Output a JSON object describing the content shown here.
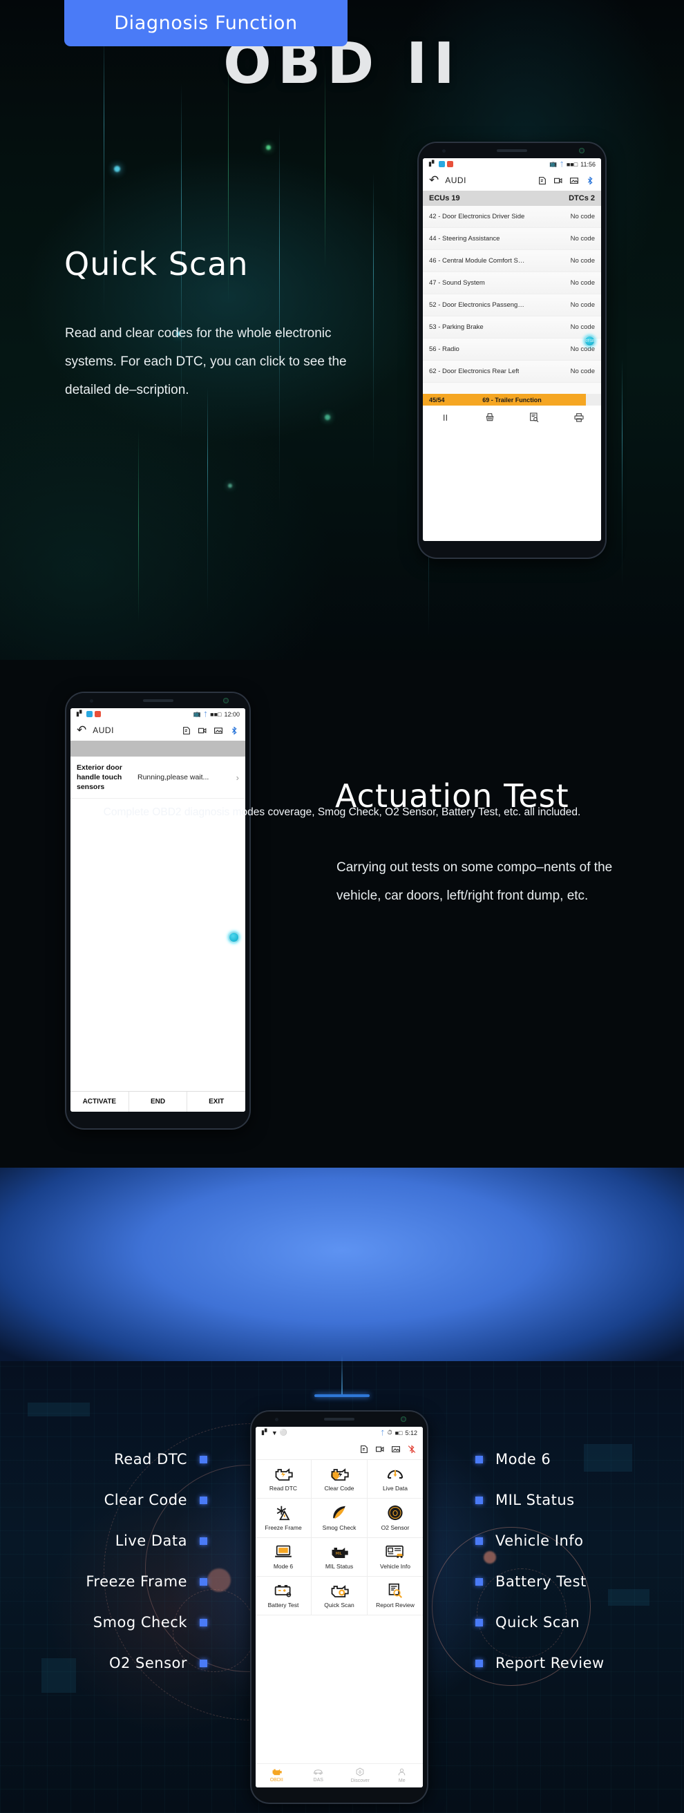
{
  "banner": {
    "title": "Diagnosis Function"
  },
  "section_quick_scan": {
    "title": "Quick Scan",
    "paragraph": "Read and clear codes for the whole electronic systems. For each DTC, you can click to see the detailed de–scription."
  },
  "section_actuation": {
    "title": "Actuation Test",
    "paragraph": "Carrying out tests on some compo–nents of the vehicle, car doors, left/right front dump, etc."
  },
  "phone_quick_scan": {
    "status": {
      "time": "11:56",
      "bluetooth_icon": "bluetooth-icon",
      "battery_icon": "battery-icon",
      "signal_icon": "signal-icon",
      "cast_icon": "cast-icon"
    },
    "appbar": {
      "back_icon": "back-arrow-icon",
      "title": "AUDI",
      "icons": [
        "note-edit-icon",
        "video-record-icon",
        "screenshot-icon",
        "bluetooth-connected-icon"
      ]
    },
    "table_header": {
      "left": "ECUs 19",
      "right": "DTCs 2"
    },
    "rows": [
      {
        "name": "42 - Door Electronics Driver Side",
        "code": "No code"
      },
      {
        "name": "44 - Steering Assistance",
        "code": "No code"
      },
      {
        "name": "46 - Central Module Comfort Sy...",
        "code": "No code"
      },
      {
        "name": "47 - Sound System",
        "code": "No code"
      },
      {
        "name": "52 - Door Electronics Passenge...",
        "code": "No code"
      },
      {
        "name": "53 - Parking Brake",
        "code": "No code"
      },
      {
        "name": "56 - Radio",
        "code": "No code"
      },
      {
        "name": "62 - Door Electronics Rear Left",
        "code": "No code"
      }
    ],
    "progress": {
      "count": "45/54",
      "label": "69 - Trailer Function"
    },
    "toolbar_icons": [
      "pause-icon",
      "erase-icon",
      "report-icon",
      "print-icon"
    ],
    "fab_label": "07:18"
  },
  "phone_actuation": {
    "status": {
      "time": "12:00"
    },
    "appbar": {
      "title": "AUDI"
    },
    "row": {
      "name": "Exterior door handle touch sensors",
      "status": "Running,please wait...",
      "chevron": "chevron-right-icon"
    },
    "buttons": [
      "ACTIVATE",
      "END",
      "EXIT"
    ],
    "fab_label": ""
  },
  "obd": {
    "title": "OBD II",
    "subtitle": "Complete OBD2 diagnosis modes coverage, Smog Check, O2 Sensor, Battery Test, etc. all included."
  },
  "features": {
    "left": [
      "Read DTC",
      "Clear Code",
      "Live Data",
      "Freeze Frame",
      "Smog Check",
      "O2 Sensor"
    ],
    "right": [
      "Mode 6",
      "MIL Status",
      "Vehicle Info",
      "Battery Test",
      "Quick Scan",
      "Report Review"
    ]
  },
  "phone_obd": {
    "status": {
      "time": "5:12"
    },
    "appbar_icons": [
      "note-edit-icon",
      "video-record-icon",
      "screenshot-icon",
      "bluetooth-disconnected-icon"
    ],
    "grid": [
      {
        "label": "Read DTC",
        "icon": "engine-bolt-icon"
      },
      {
        "label": "Clear Code",
        "icon": "engine-erase-icon"
      },
      {
        "label": "Live Data",
        "icon": "gauge-icon"
      },
      {
        "label": "Freeze Frame",
        "icon": "snowflake-warning-icon"
      },
      {
        "label": "Smog Check",
        "icon": "smoke-icon"
      },
      {
        "label": "O2 Sensor",
        "icon": "o2-sensor-icon"
      },
      {
        "label": "Mode 6",
        "icon": "laptop-mode6-icon"
      },
      {
        "label": "MIL Status",
        "icon": "engine-mil-icon"
      },
      {
        "label": "Vehicle Info",
        "icon": "vehicle-card-icon"
      },
      {
        "label": "Battery Test",
        "icon": "battery-test-icon"
      },
      {
        "label": "Quick Scan",
        "icon": "engine-scan-icon"
      },
      {
        "label": "Report Review",
        "icon": "report-search-icon"
      }
    ],
    "nav": [
      {
        "label": "OBDII",
        "icon": "engine-icon",
        "active": true
      },
      {
        "label": "DAS",
        "icon": "car-icon",
        "active": false
      },
      {
        "label": "Discover",
        "icon": "compass-icon",
        "active": false
      },
      {
        "label": "Me",
        "icon": "person-icon",
        "active": false
      }
    ]
  },
  "colors": {
    "accent_blue": "#4a7bf7",
    "orange": "#f5a623",
    "obd_blue": "#4d82e8"
  }
}
